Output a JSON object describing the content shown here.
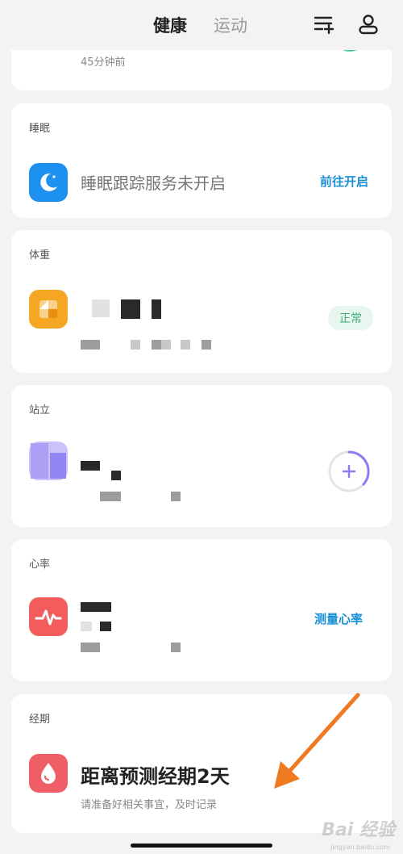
{
  "header": {
    "tab_health": "健康",
    "tab_sport": "运动",
    "icons": [
      "edit-list-icon",
      "user-icon"
    ]
  },
  "top_card": {
    "time_ago": "45分钟前"
  },
  "sleep_card": {
    "title": "睡眠",
    "icon": "moon-icon",
    "message": "睡眠跟踪服务未开启",
    "action": "前往开启"
  },
  "weight_card": {
    "title": "体重",
    "icon": "weight-icon",
    "status": "正常"
  },
  "stand_card": {
    "title": "站立",
    "icon": "standing-icon",
    "ring_color": "#8b7cf0"
  },
  "heart_card": {
    "title": "心率",
    "icon": "heart-rate-icon",
    "action": "测量心率"
  },
  "period_card": {
    "title": "经期",
    "icon": "drop-icon",
    "message": "距离预测经期2天",
    "sub": "请准备好相关事宜，及时记录"
  },
  "watermark": {
    "text": "Bai 经验",
    "sub": "jingyan.baidu.com"
  },
  "colors": {
    "accent_blue": "#1a8fd6",
    "arrow_orange": "#f07a22"
  }
}
